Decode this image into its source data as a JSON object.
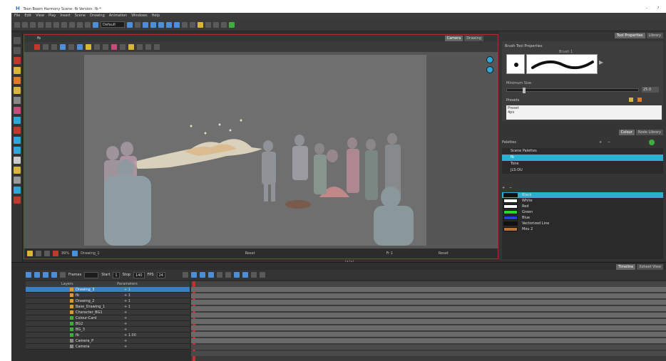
{
  "window": {
    "title": "Toon Boom Harmony Scene: fb Version: fb *",
    "min_label": "–",
    "help_label": "?"
  },
  "menu": [
    "File",
    "Edit",
    "View",
    "Play",
    "Insert",
    "Scene",
    "Drawing",
    "Animation",
    "Windows",
    "Help"
  ],
  "toolbar": {
    "preset": "Default"
  },
  "camera": {
    "tabs": [
      "Camera",
      "Drawing"
    ],
    "header_label": "fb",
    "status_zoom": "99%",
    "status_layer": "Drawing_1",
    "status_mode": "Reset",
    "status_frame": "Fr 1",
    "status_render": "Reset",
    "divider_label": "|∧|∨|"
  },
  "tool_properties": {
    "tabs": [
      "Tool Properties",
      "Library"
    ],
    "title": "Brush Tool Properties",
    "brush_name": "Brush 1",
    "min_size_label": "Minimum Size",
    "size_value": "25.0",
    "presets_label": "Presets",
    "preset_items": [
      "Preset",
      "4px"
    ]
  },
  "colour": {
    "tabs": [
      "Colour",
      "Node Library"
    ],
    "palettes_label": "Palettes",
    "palettes": [
      "Scene Palettes",
      "fb",
      "Tone",
      "JLS-DU"
    ],
    "selected_palette_index": 1,
    "colors": [
      {
        "name": "Black",
        "hex": "#111111"
      },
      {
        "name": "White",
        "hex": "#ffffff"
      },
      {
        "name": "Red",
        "hex": "#ffffff"
      },
      {
        "name": "Green",
        "hex": "#2bd62b"
      },
      {
        "name": "Blue",
        "hex": "#2a3fe0"
      },
      {
        "name": "Vectorized Line",
        "hex": "#111111"
      },
      {
        "name": "Mou 2",
        "hex": "#b8743a"
      }
    ],
    "selected_color_index": 0
  },
  "timeline": {
    "tabs": [
      "Timeline",
      "Xsheet View"
    ],
    "frames_label": "Frames",
    "start_label": "Start",
    "start_value": "1",
    "stop_label": "Stop",
    "stop_value": "140",
    "fps_label": "FPS",
    "fps_value": "24",
    "layer_col_header": "Layers",
    "params_col_header": "Parameters",
    "layers": [
      {
        "name": "Drawing_3",
        "param": "1",
        "color": "#d89a3c",
        "selected": true
      },
      {
        "name": "fb",
        "param": "1",
        "color": "#d89a3c",
        "selected": false
      },
      {
        "name": "Drawing_2",
        "param": "1",
        "color": "#d89a3c",
        "selected": false
      },
      {
        "name": "Base_Drawing_1",
        "param": "1",
        "color": "#d89a3c",
        "selected": false
      },
      {
        "name": "Character_BG1",
        "param": "",
        "color": "#d89a3c",
        "selected": false
      },
      {
        "name": "Colour-Card",
        "param": "",
        "color": "#3fae3f",
        "selected": false
      },
      {
        "name": "BG2",
        "param": "",
        "color": "#3fae3f",
        "selected": false
      },
      {
        "name": "BG_3",
        "param": "",
        "color": "#3fae3f",
        "selected": false
      },
      {
        "name": "fb",
        "param": "1.00",
        "color": "#3fae3f",
        "selected": false
      },
      {
        "name": "Camera_P",
        "param": "",
        "color": "#888888",
        "selected": false
      },
      {
        "name": "Camera",
        "param": "",
        "color": "#888888",
        "selected": false
      }
    ]
  }
}
